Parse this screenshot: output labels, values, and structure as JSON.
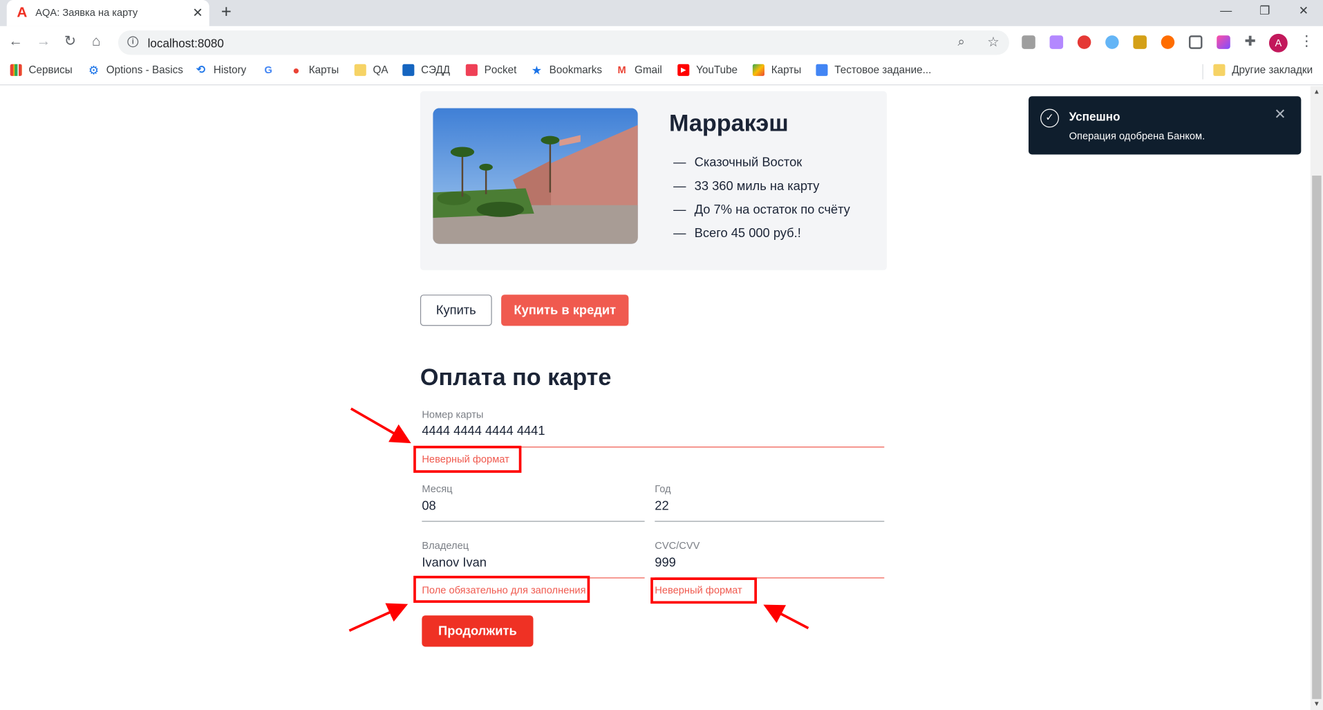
{
  "browser": {
    "tab_title": "AQA: Заявка на карту",
    "url": "localhost:8080",
    "profile_initial": "A"
  },
  "bookmarks": {
    "items": [
      "Сервисы",
      "Options - Basics",
      "History",
      "Карты",
      "QA",
      "СЭДД",
      "Pocket",
      "Bookmarks",
      "Gmail",
      "YouTube",
      "Карты",
      "Тестовое задание..."
    ],
    "other": "Другие закладки"
  },
  "tour": {
    "city": "Марракэш",
    "features": [
      "Сказочный Восток",
      "33 360 миль на карту",
      "До 7% на остаток по счёту",
      "Всего 45 000 руб.!"
    ],
    "dash": "—"
  },
  "actions": {
    "buy_label": "Купить",
    "credit_label": "Купить в кредит"
  },
  "form": {
    "title": "Оплата по карте",
    "card_number": {
      "label": "Номер карты",
      "value": "4444 4444 4444 4441",
      "error": "Неверный формат"
    },
    "month": {
      "label": "Месяц",
      "value": "08"
    },
    "year": {
      "label": "Год",
      "value": "22"
    },
    "owner": {
      "label": "Владелец",
      "value": "Ivanov Ivan",
      "error": "Поле обязательно для заполнения"
    },
    "cvc": {
      "label": "CVC/CVV",
      "value": "999",
      "error": "Неверный формат"
    },
    "continue_label": "Продолжить"
  },
  "notification": {
    "title": "Успешно",
    "message": "Операция одобрена Банком."
  },
  "colors": {
    "accent": "#ef3124",
    "error": "#f05a4f",
    "toast_bg": "#0f1e2d",
    "annotation": "#ff0000"
  }
}
